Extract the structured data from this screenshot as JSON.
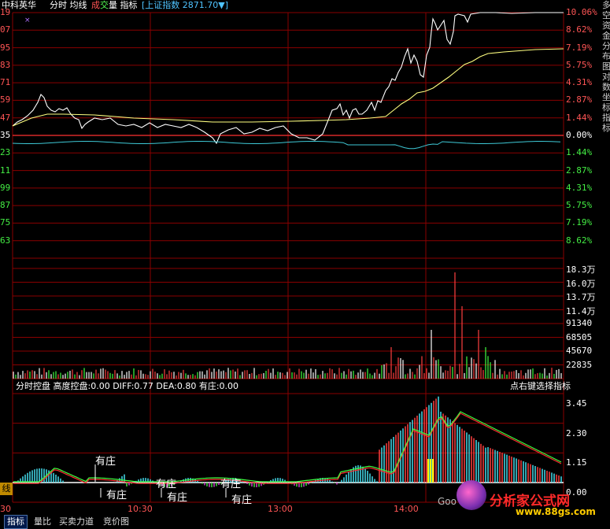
{
  "header": {
    "stock_name": "中科英华",
    "items": [
      {
        "key": "time",
        "label": "分时",
        "color": "#ffffff"
      },
      {
        "key": "avg",
        "label": "均线",
        "color": "#ffff66"
      },
      {
        "key": "vol_a",
        "label": "成",
        "color": "#ff4444"
      },
      {
        "key": "vol_b",
        "label": "交",
        "color": "#44ff44"
      },
      {
        "key": "vol_c",
        "label": "量",
        "color": "#ffffff"
      },
      {
        "key": "ind",
        "label": "指标",
        "color": "#ffffff"
      }
    ],
    "index_label": "[上证指数",
    "index_value": "2871.70",
    "index_arrow": "▼]"
  },
  "left_price_labels": [
    "19",
    "07",
    "95",
    "83",
    "71",
    "59",
    "47",
    "35",
    "23",
    "11",
    "99",
    "87",
    "75",
    "63"
  ],
  "right_pct_labels": [
    "10.06%",
    "8.62%",
    "7.19%",
    "5.75%",
    "4.31%",
    "2.87%",
    "1.44%",
    "0.00%",
    "1.44%",
    "2.87%",
    "4.31%",
    "5.75%",
    "7.19%",
    "8.62%"
  ],
  "volume_labels": [
    "18.3万",
    "16.0万",
    "13.7万",
    "11.4万",
    "91340",
    "68505",
    "45670",
    "22835"
  ],
  "indicator_bar": {
    "left_text": "分时控盘  高度控盘:0.00  DIFF:0.77  DEA:0.80  有庄:0.00",
    "right_text": "点右键选择指标"
  },
  "indicator_labels": [
    "3.45",
    "2.30",
    "1.15",
    "0.00"
  ],
  "annotations": [
    "有庄",
    "有庄",
    "有庄",
    "有庄",
    "有庄",
    "有庄"
  ],
  "time_labels": [
    "30",
    "10:30",
    "13:00",
    "14:00"
  ],
  "left_tab_cut": "线",
  "bottom_tabs": [
    "指标",
    "量比",
    "买卖力道",
    "竞价图"
  ],
  "watermark": {
    "site_name": "分析家公式网",
    "site_url": "www.88gs.com",
    "faint_text": "Goo"
  },
  "side_strip_text": "多空资金分布图 对数坐标 指标"
}
